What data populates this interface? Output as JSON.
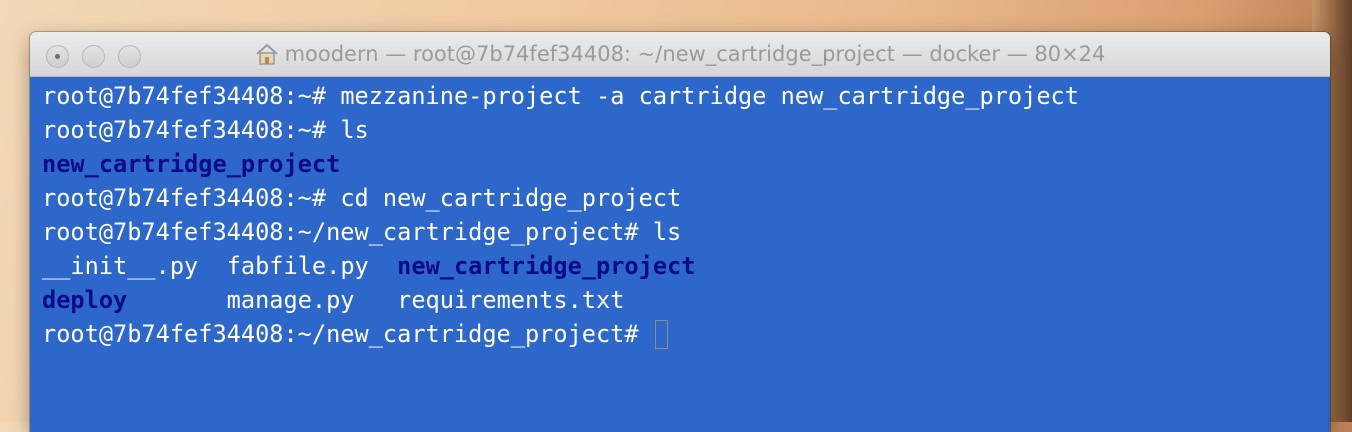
{
  "window": {
    "title": "moodern — root@7b74fef34408: ~/new_cartridge_project — docker — 80×24"
  },
  "terminal": {
    "lines": [
      {
        "prompt": "root@7b74fef34408:~# ",
        "command": "mezzanine-project -a cartridge new_cartridge_project"
      },
      {
        "prompt": "root@7b74fef34408:~# ",
        "command": "ls"
      },
      {
        "dir": "new_cartridge_project"
      },
      {
        "prompt": "root@7b74fef34408:~# ",
        "command": "cd new_cartridge_project"
      },
      {
        "prompt": "root@7b74fef34408:~/new_cartridge_project# ",
        "command": "ls"
      },
      {
        "col1": "__init__.py",
        "col2": "fabfile.py",
        "col3_dir": "new_cartridge_project"
      },
      {
        "col1_dir": "deploy",
        "col2": "manage.py",
        "col3": "requirements.txt"
      },
      {
        "prompt": "root@7b74fef34408:~/new_cartridge_project# ",
        "command": ""
      }
    ]
  },
  "colors": {
    "terminal_bg": "#2d67c9",
    "text": "#ffffff",
    "directory": "#0a0a8a"
  },
  "icons": {
    "title_icon": "home-icon",
    "cursor": "block-cursor"
  }
}
